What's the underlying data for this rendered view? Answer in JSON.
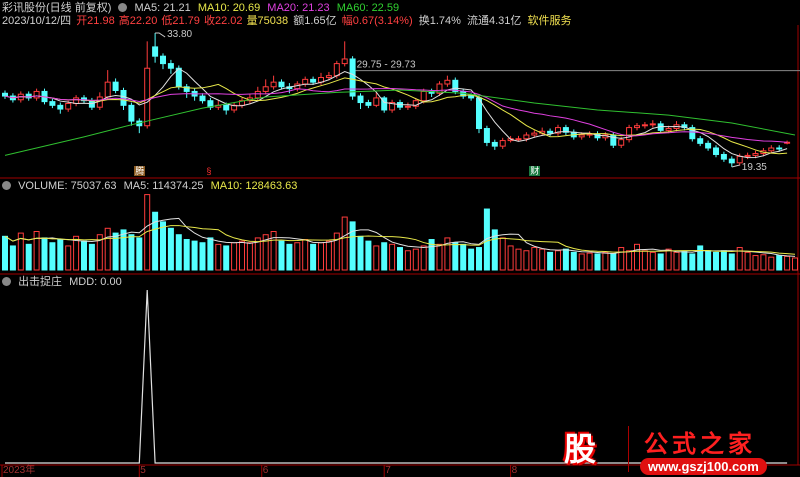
{
  "header": {
    "title": "彩讯股份(日线 前复权)",
    "ma5": "MA5: 21.21",
    "ma10": "MA10: 20.69",
    "ma20": "MA20: 21.23",
    "ma60": "MA60: 22.59",
    "date": "2023/10/12/四",
    "open": "开21.98",
    "high": "高22.20",
    "low": "低21.79",
    "close": "收22.02",
    "volume": "量75038",
    "amount": "额1.65亿",
    "change": "幅0.67(3.14%)",
    "turnover": "换1.74%",
    "float": "流通4.31亿",
    "sector": "软件服务"
  },
  "volume_header": {
    "volume": "VOLUME: 75037.63",
    "ma5": "MA5: 114374.25",
    "ma10": "MA10: 128463.63"
  },
  "indicator_header": {
    "name": "出击捉庄",
    "value": "MDD: 0.00"
  },
  "markers": [
    {
      "text": "腾",
      "index": 17,
      "color": "#8a5a20"
    },
    {
      "text": "§",
      "index": 26,
      "color": "#000000"
    },
    {
      "text": "财",
      "index": 67,
      "color": "#1a7a40"
    }
  ],
  "logo": {
    "glyph": "股",
    "name": "公式之家",
    "url": "www.gszj100.com"
  },
  "colors": {
    "up": "#ff3c3c",
    "down": "#54ffff",
    "ma5": "#e0e0e0",
    "ma10": "#e8e84a",
    "ma20": "#e040e0",
    "ma60": "#30c030",
    "divider": "#a00000"
  },
  "chart_data": [
    {
      "type": "candlestick",
      "ylim": [
        19.35,
        33.8
      ],
      "annotations": {
        "max_label": "33.80",
        "min_label": "19.35",
        "line_label": "29.75 - 29.73",
        "line_value": 29.74
      },
      "candles_ohlc": [
        [
          27.3,
          27.6,
          26.7,
          27.0
        ],
        [
          27.0,
          27.3,
          26.3,
          26.6
        ],
        [
          26.6,
          27.5,
          26.3,
          27.2
        ],
        [
          27.2,
          27.5,
          26.5,
          26.8
        ],
        [
          26.8,
          27.8,
          26.5,
          27.5
        ],
        [
          27.5,
          27.8,
          26.1,
          26.4
        ],
        [
          26.4,
          26.7,
          25.7,
          26.0
        ],
        [
          26.0,
          26.3,
          25.1,
          25.6
        ],
        [
          25.6,
          26.5,
          25.3,
          26.2
        ],
        [
          26.2,
          27.1,
          25.9,
          26.8
        ],
        [
          26.8,
          27.1,
          26.2,
          26.5
        ],
        [
          26.5,
          26.8,
          25.5,
          25.8
        ],
        [
          25.8,
          27.4,
          25.5,
          26.9
        ],
        [
          26.9,
          29.8,
          26.6,
          28.5
        ],
        [
          28.5,
          28.9,
          27.3,
          27.6
        ],
        [
          27.6,
          27.9,
          25.5,
          26.0
        ],
        [
          26.0,
          26.3,
          23.8,
          24.3
        ],
        [
          24.3,
          24.6,
          23.0,
          23.8
        ],
        [
          23.8,
          32.9,
          23.5,
          30.0
        ],
        [
          32.3,
          33.8,
          30.6,
          31.3
        ],
        [
          31.3,
          31.6,
          29.9,
          30.5
        ],
        [
          30.5,
          30.9,
          29.4,
          30.0
        ],
        [
          30.0,
          30.3,
          27.7,
          28.0
        ],
        [
          28.0,
          28.3,
          26.8,
          27.5
        ],
        [
          27.5,
          27.8,
          26.5,
          27.0
        ],
        [
          27.0,
          27.3,
          26.2,
          26.5
        ],
        [
          26.5,
          26.8,
          25.5,
          25.8
        ],
        [
          25.8,
          26.5,
          25.5,
          26.0
        ],
        [
          26.0,
          26.3,
          25.0,
          25.5
        ],
        [
          25.5,
          26.3,
          25.2,
          26.0
        ],
        [
          26.0,
          26.8,
          25.7,
          26.5
        ],
        [
          26.5,
          27.2,
          26.2,
          26.8
        ],
        [
          26.8,
          28.0,
          26.5,
          27.5
        ],
        [
          27.5,
          28.8,
          27.2,
          28.0
        ],
        [
          28.0,
          29.2,
          27.7,
          28.5
        ],
        [
          28.5,
          28.8,
          27.7,
          28.0
        ],
        [
          28.0,
          28.4,
          27.3,
          27.8
        ],
        [
          27.8,
          28.6,
          27.5,
          28.3
        ],
        [
          28.3,
          29.1,
          28.0,
          28.8
        ],
        [
          28.8,
          29.1,
          28.2,
          28.5
        ],
        [
          28.5,
          29.5,
          28.2,
          29.0
        ],
        [
          29.0,
          29.6,
          28.7,
          29.2
        ],
        [
          29.2,
          30.8,
          28.9,
          30.5
        ],
        [
          30.5,
          32.9,
          30.2,
          31.0
        ],
        [
          31.0,
          31.3,
          26.6,
          27.0
        ],
        [
          27.0,
          27.3,
          25.6,
          26.3
        ],
        [
          26.3,
          26.6,
          25.7,
          26.0
        ],
        [
          26.0,
          27.4,
          25.8,
          26.8
        ],
        [
          26.8,
          27.0,
          25.2,
          25.5
        ],
        [
          25.5,
          26.6,
          25.2,
          26.3
        ],
        [
          26.3,
          26.6,
          25.5,
          25.8
        ],
        [
          25.8,
          26.3,
          25.5,
          25.9
        ],
        [
          25.9,
          26.8,
          25.6,
          26.5
        ],
        [
          26.5,
          27.8,
          26.2,
          27.5
        ],
        [
          27.5,
          27.8,
          26.9,
          27.3
        ],
        [
          27.3,
          28.6,
          27.0,
          28.3
        ],
        [
          28.3,
          29.2,
          28.0,
          28.7
        ],
        [
          28.7,
          29.0,
          27.2,
          27.5
        ],
        [
          27.5,
          27.8,
          26.7,
          27.0
        ],
        [
          27.0,
          27.3,
          26.5,
          26.8
        ],
        [
          26.8,
          27.0,
          23.0,
          23.5
        ],
        [
          23.5,
          23.8,
          21.6,
          22.0
        ],
        [
          22.0,
          22.3,
          21.2,
          21.6
        ],
        [
          21.6,
          22.5,
          21.3,
          22.2
        ],
        [
          22.2,
          22.7,
          22.0,
          22.4
        ],
        [
          22.4,
          22.7,
          22.1,
          22.4
        ],
        [
          22.4,
          23.1,
          22.1,
          22.8
        ],
        [
          22.8,
          23.3,
          22.5,
          23.0
        ],
        [
          23.0,
          23.6,
          22.7,
          23.2
        ],
        [
          23.2,
          23.5,
          22.7,
          23.0
        ],
        [
          23.0,
          23.9,
          22.7,
          23.6
        ],
        [
          23.6,
          23.9,
          22.8,
          23.1
        ],
        [
          23.1,
          23.4,
          22.3,
          22.6
        ],
        [
          22.6,
          23.1,
          22.3,
          22.8
        ],
        [
          22.8,
          23.2,
          22.5,
          22.9
        ],
        [
          22.9,
          23.2,
          22.2,
          22.5
        ],
        [
          22.5,
          23.1,
          22.2,
          22.8
        ],
        [
          22.8,
          23.1,
          21.4,
          21.7
        ],
        [
          21.7,
          22.6,
          21.4,
          22.3
        ],
        [
          22.3,
          23.9,
          22.0,
          23.6
        ],
        [
          23.6,
          24.1,
          23.3,
          23.8
        ],
        [
          23.8,
          24.2,
          23.5,
          23.9
        ],
        [
          23.9,
          24.4,
          23.6,
          24.0
        ],
        [
          24.0,
          24.3,
          23.0,
          23.3
        ],
        [
          23.3,
          23.8,
          23.0,
          23.5
        ],
        [
          23.5,
          24.3,
          23.2,
          23.9
        ],
        [
          23.9,
          24.2,
          23.3,
          23.6
        ],
        [
          23.6,
          23.9,
          22.1,
          22.4
        ],
        [
          22.4,
          22.7,
          21.6,
          21.9
        ],
        [
          21.9,
          22.2,
          21.1,
          21.4
        ],
        [
          21.4,
          21.7,
          20.4,
          20.7
        ],
        [
          20.7,
          21.0,
          19.9,
          20.2
        ],
        [
          20.2,
          20.5,
          19.35,
          19.8
        ],
        [
          19.8,
          20.8,
          19.5,
          20.5
        ],
        [
          20.5,
          20.9,
          20.2,
          20.6
        ],
        [
          20.6,
          21.1,
          20.3,
          20.8
        ],
        [
          20.8,
          21.4,
          20.5,
          21.1
        ],
        [
          21.1,
          21.7,
          20.8,
          21.4
        ],
        [
          21.4,
          21.7,
          21.0,
          21.35
        ],
        [
          21.98,
          22.2,
          21.79,
          22.02
        ]
      ],
      "ma60_points": [
        [
          0,
          20.6
        ],
        [
          10,
          22.6
        ],
        [
          16,
          23.9
        ],
        [
          25,
          25.7
        ],
        [
          33,
          26.9
        ],
        [
          42,
          27.4
        ],
        [
          50,
          27.65
        ],
        [
          58,
          27.3
        ],
        [
          67,
          26.25
        ],
        [
          75,
          25.5
        ],
        [
          84,
          24.95
        ],
        [
          92,
          24.1
        ],
        [
          100,
          22.8
        ]
      ],
      "x_labels": [
        {
          "text": "2023年",
          "index": -0.4
        },
        {
          "text": "5",
          "index": 17
        },
        {
          "text": "6",
          "index": 32.5
        },
        {
          "text": "7",
          "index": 48
        },
        {
          "text": "8",
          "index": 64
        }
      ]
    },
    {
      "type": "bar",
      "name": "VOLUME",
      "ylim": [
        0,
        480000
      ],
      "values": [
        210000,
        150000,
        230000,
        160000,
        240000,
        200000,
        170000,
        190000,
        150000,
        210000,
        180000,
        160000,
        220000,
        260000,
        230000,
        250000,
        220000,
        200000,
        470000,
        360000,
        300000,
        260000,
        220000,
        190000,
        180000,
        170000,
        200000,
        160000,
        150000,
        170000,
        180000,
        170000,
        200000,
        220000,
        240000,
        180000,
        160000,
        170000,
        190000,
        160000,
        170000,
        180000,
        230000,
        330000,
        300000,
        210000,
        180000,
        150000,
        170000,
        160000,
        140000,
        120000,
        130000,
        150000,
        190000,
        160000,
        200000,
        170000,
        160000,
        130000,
        140000,
        380000,
        250000,
        200000,
        150000,
        130000,
        120000,
        140000,
        130000,
        110000,
        120000,
        130000,
        110000,
        100000,
        105000,
        100000,
        110000,
        100000,
        140000,
        120000,
        160000,
        120000,
        110000,
        100000,
        130000,
        110000,
        115000,
        100000,
        150000,
        120000,
        110000,
        120000,
        100000,
        140000,
        110000,
        90000,
        95000,
        80000,
        90000,
        85000,
        75037
      ]
    },
    {
      "type": "line",
      "name": "MDD",
      "ylim": [
        0,
        1
      ],
      "values_nonzero": [
        [
          18,
          1
        ]
      ],
      "baseline": 0
    }
  ]
}
